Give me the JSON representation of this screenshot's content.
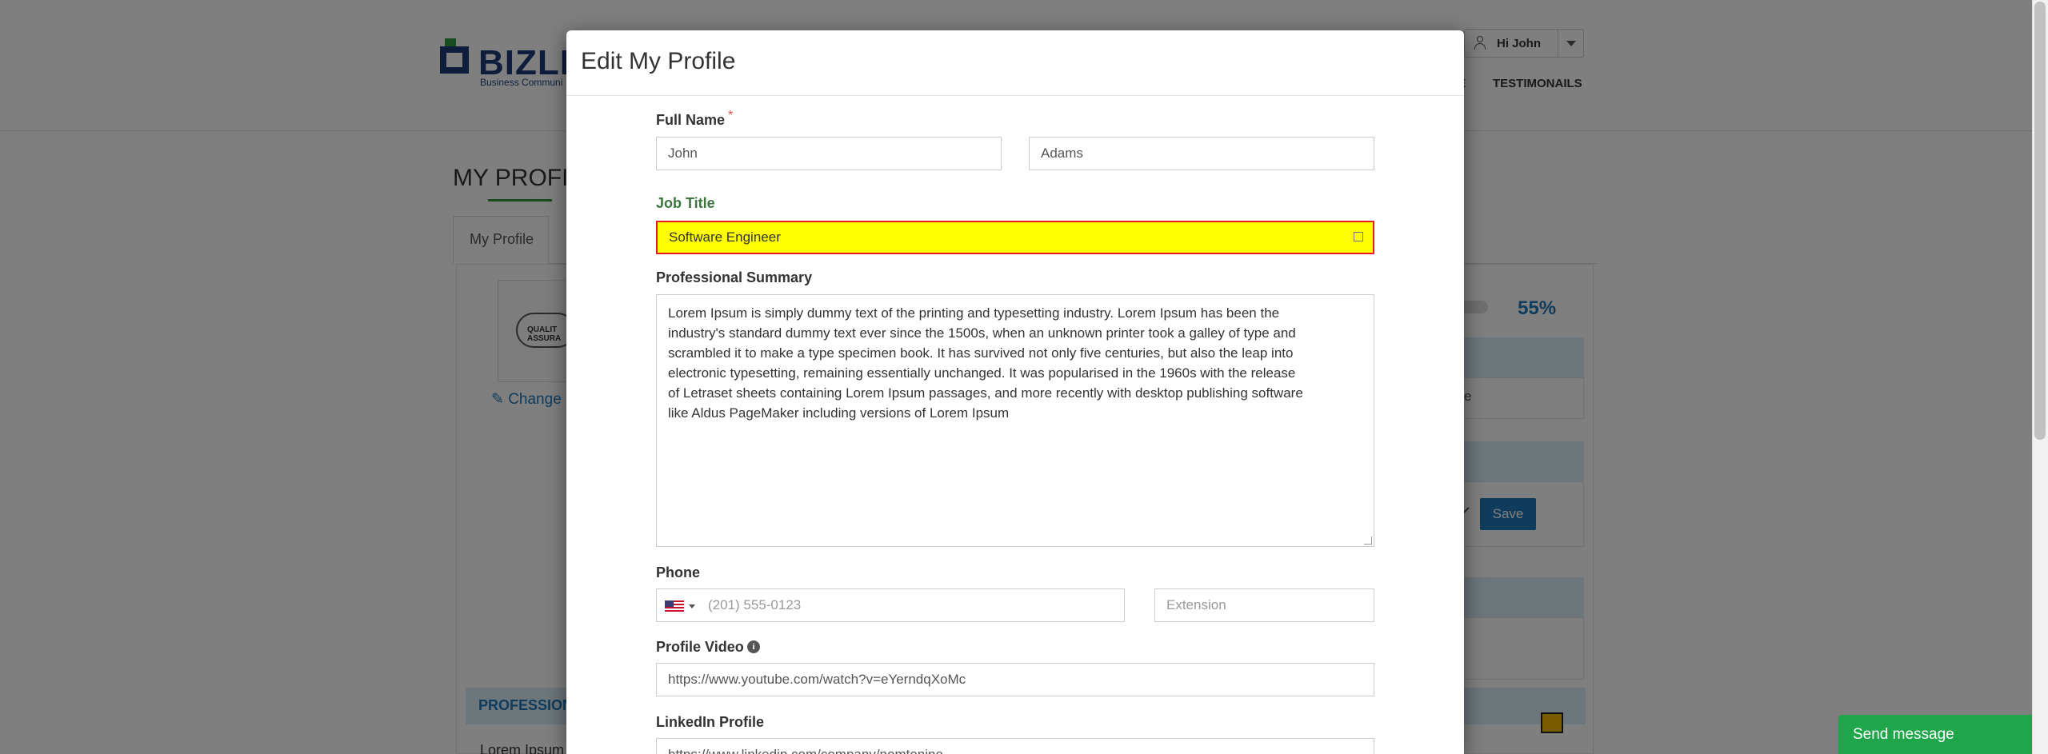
{
  "background": {
    "logo_text": "BIZLI",
    "logo_sub": "Business Communi",
    "user_menu_label": "Hi John",
    "nav_partial": "E",
    "nav_testimonials": "TESTIMONAILS",
    "page_title": "MY PROFIL",
    "tab_active": "My Profile",
    "change_link": "✎ Change",
    "avatar_text": "QUALIT ASSURA",
    "progress_percent": "55%",
    "bg_partial_text": "e",
    "save_label": "Save",
    "section_header": "PROFESSION",
    "lorem_partial": "Lorem Ipsum"
  },
  "modal": {
    "title": "Edit My Profile",
    "full_name": {
      "label": "Full Name",
      "required_mark": "*",
      "first_value": "John",
      "last_value": "Adams"
    },
    "job_title": {
      "label": "Job Title",
      "value": "Software Engineer"
    },
    "summary": {
      "label": "Professional Summary",
      "lines": [
        "Lorem Ipsum is simply dummy text of the printing and typesetting industry. Lorem Ipsum has been the",
        "industry's standard dummy text ever since the 1500s, when an unknown printer took a galley of type and",
        "scrambled it to make a type specimen book. It has survived not only five centuries, but also the leap into",
        "electronic typesetting, remaining essentially unchanged. It was popularised in the 1960s with the release",
        "of Letraset sheets containing Lorem Ipsum passages, and more recently with desktop publishing software",
        "like Aldus PageMaker including versions of Lorem Ipsum"
      ]
    },
    "phone": {
      "label": "Phone",
      "placeholder": "(201) 555-0123",
      "extension_placeholder": "Extension"
    },
    "video": {
      "label": "Profile Video",
      "value": "https://www.youtube.com/watch?v=eYerndqXoMc"
    },
    "linkedin": {
      "label": "LinkedIn Profile",
      "value": "https://www.linkedin.com/company/nomtonine"
    }
  },
  "chat": {
    "send_label": "Send message"
  }
}
